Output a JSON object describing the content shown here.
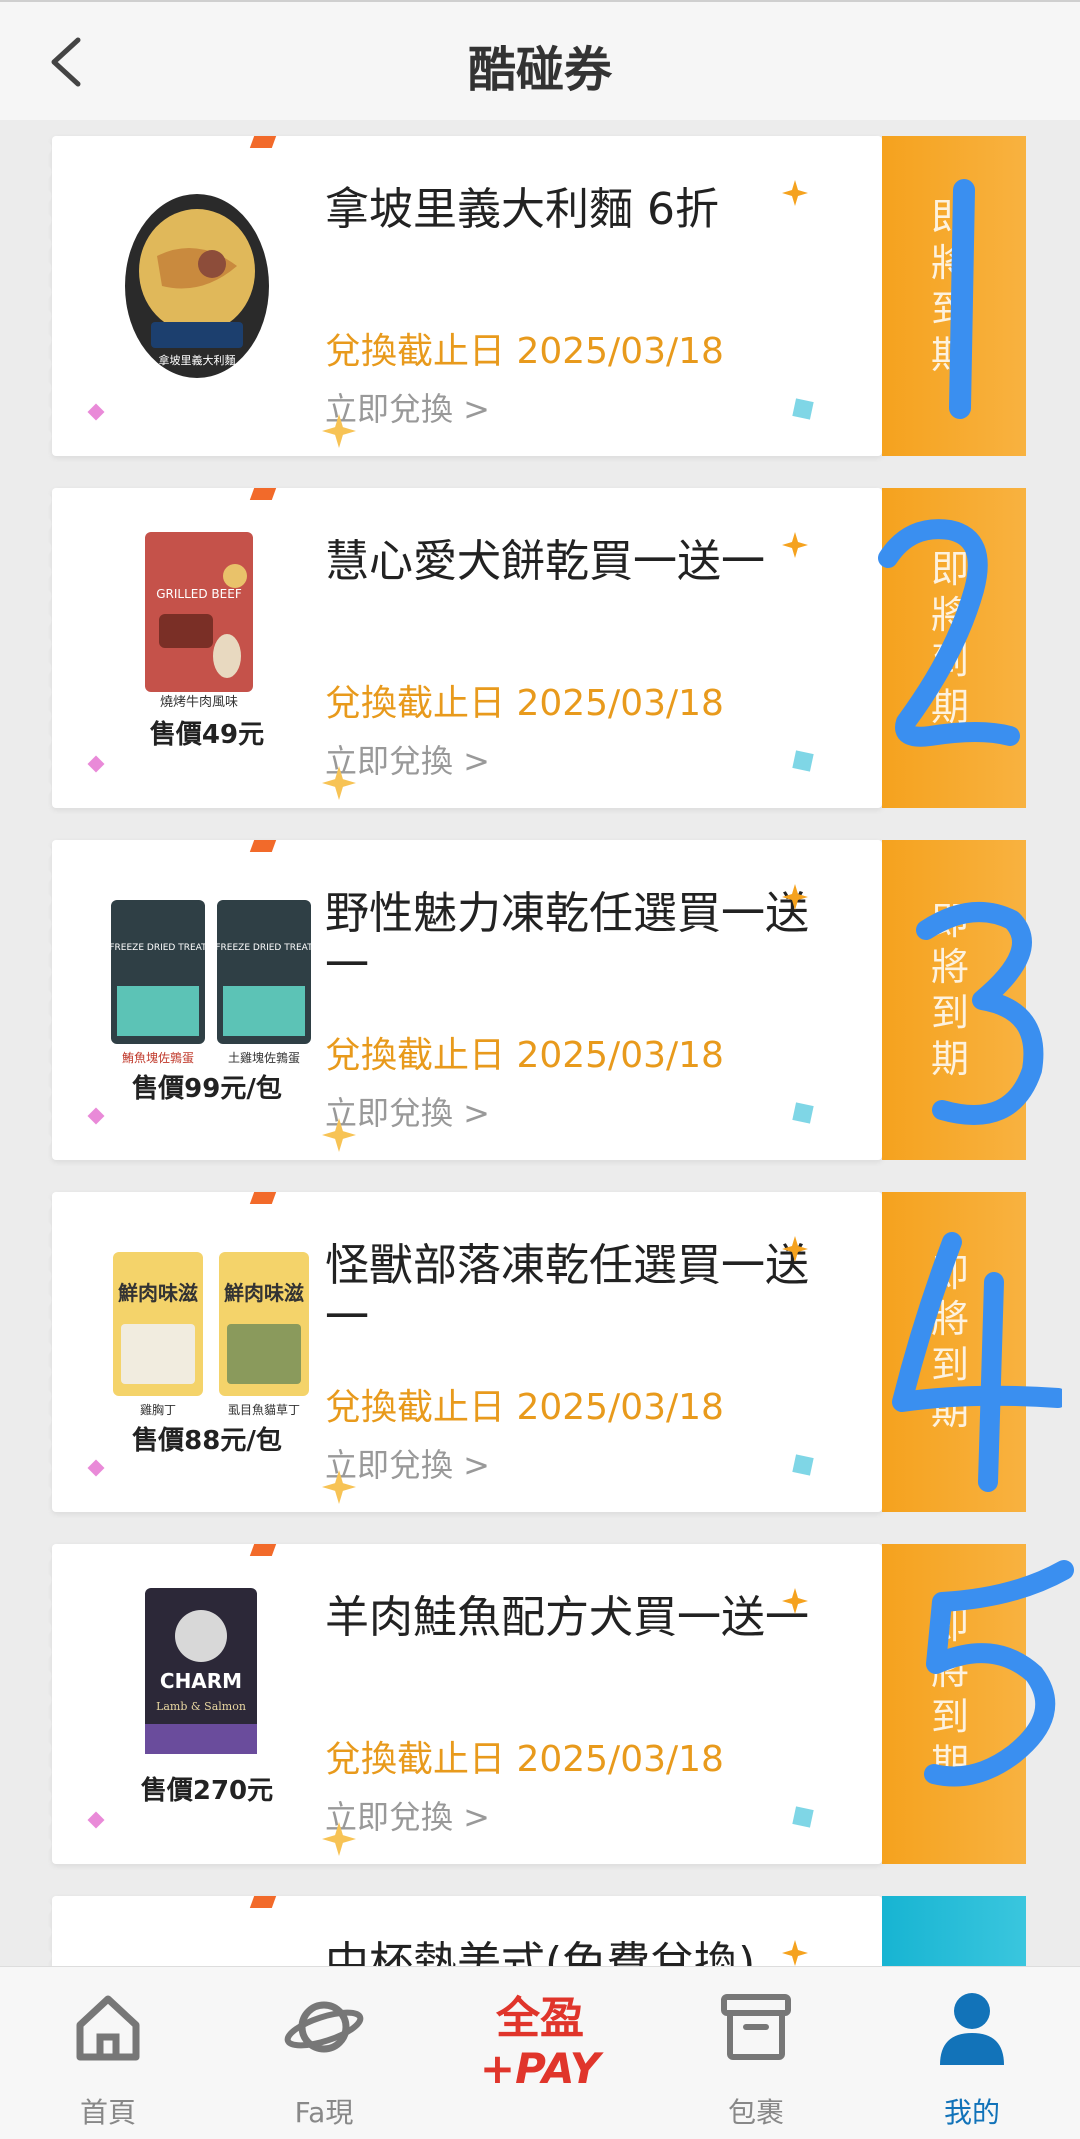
{
  "header": {
    "title": "酷碰券"
  },
  "coupons": [
    {
      "title": "拿坡里義大利麵 6折",
      "price": "",
      "expiry": "兌換截止日 2025/03/18",
      "redeem": "立即兌換 >",
      "stub_label": "即將到期",
      "stub_color": "#f5a21e",
      "handwritten": "1"
    },
    {
      "title": "慧心愛犬餅乾買一送一",
      "price": "售價49元",
      "img_caption": "燒烤牛肉風味",
      "expiry": "兌換截止日 2025/03/18",
      "redeem": "立即兌換 >",
      "stub_label": "即將到期",
      "stub_color": "#f5a21e",
      "handwritten": "2"
    },
    {
      "title": "野性魅力凍乾任選買一送一",
      "price": "售價99元/包",
      "img_caption": "鮪魚塊佐鶉蛋",
      "img_caption2": "土雞塊佐鶉蛋",
      "expiry": "兌換截止日 2025/03/18",
      "redeem": "立即兌換 >",
      "stub_label": "即將到期",
      "stub_color": "#f5a21e",
      "handwritten": "3"
    },
    {
      "title": "怪獸部落凍乾任選買一送一",
      "price": "售價88元/包",
      "img_caption": "雞胸丁",
      "img_caption2": "虱目魚貓草丁",
      "expiry": "兌換截止日 2025/03/18",
      "redeem": "立即兌換 >",
      "stub_label": "即將到期",
      "stub_color": "#f5a21e",
      "handwritten": "4"
    },
    {
      "title": "羊肉鮭魚配方犬買一送一",
      "price": "售價270元",
      "expiry": "兌換截止日 2025/03/18",
      "redeem": "立即兌換 >",
      "stub_label": "即將到期",
      "stub_color": "#f5a21e",
      "handwritten": "5"
    },
    {
      "title": "中杯熱美式(免費兌換)",
      "stub_color": "#17b4d2"
    }
  ],
  "product_art": {
    "pasta": "拿坡里義大利麵",
    "beef": "GRILLED BEEF",
    "treat": "FREEZE DRIED TREAT",
    "meat": "鮮肉味滋",
    "charm": "CHARM",
    "charm_sub": "Lamb & Salmon"
  },
  "nav": {
    "items": [
      {
        "label": "首頁",
        "icon": "home-icon"
      },
      {
        "label": "Fa現",
        "icon": "planet-icon"
      },
      {
        "label": "",
        "icon": "quanying-pay-logo",
        "logo_top": "全盈",
        "logo_bottom": "+PAY"
      },
      {
        "label": "包裹",
        "icon": "package-box-icon"
      },
      {
        "label": "我的",
        "icon": "profile-icon",
        "active": true
      }
    ]
  },
  "colors": {
    "accent": "#e89a1c",
    "stub": "#f5a21e",
    "nav_active": "#1273b9",
    "pen": "#3a8ff0"
  }
}
